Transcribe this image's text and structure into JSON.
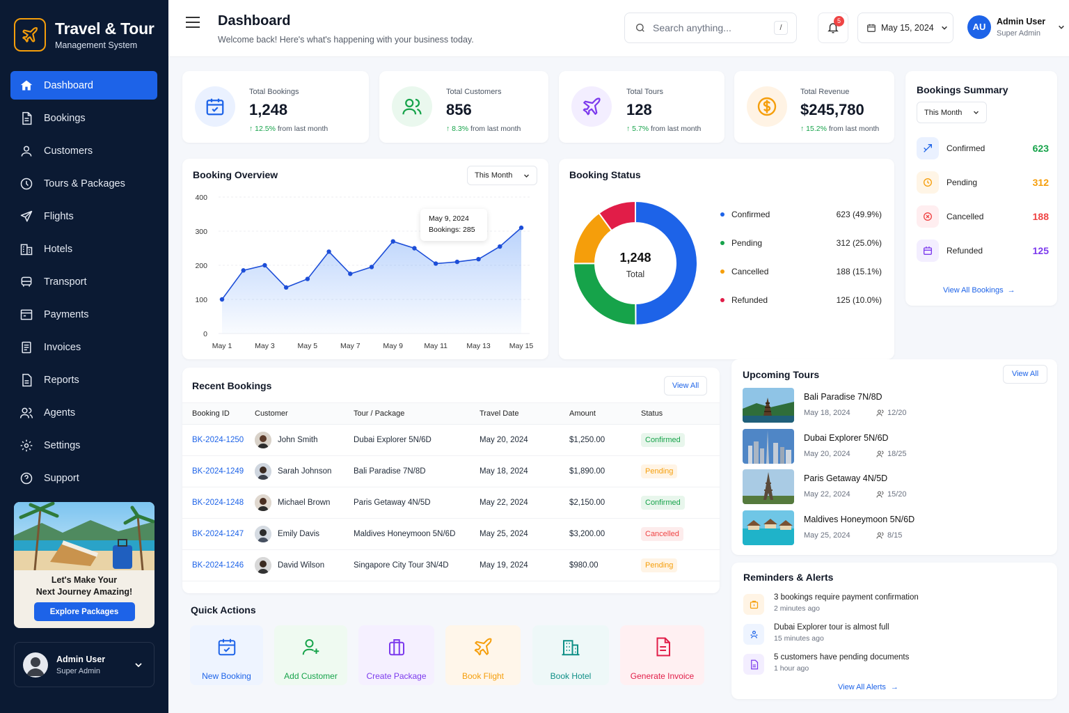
{
  "app": {
    "title": "Travel & Tour",
    "subtitle": "Management System"
  },
  "nav": [
    {
      "label": "Dashboard",
      "icon": "home-icon"
    },
    {
      "label": "Bookings",
      "icon": "document-icon"
    },
    {
      "label": "Customers",
      "icon": "user-icon"
    },
    {
      "label": "Tours & Packages",
      "icon": "compass-icon"
    },
    {
      "label": "Flights",
      "icon": "plane-icon"
    },
    {
      "label": "Hotels",
      "icon": "building-icon"
    },
    {
      "label": "Transport",
      "icon": "bus-icon"
    },
    {
      "label": "Payments",
      "icon": "card-icon"
    },
    {
      "label": "Invoices",
      "icon": "invoice-icon"
    },
    {
      "label": "Reports",
      "icon": "report-icon"
    },
    {
      "label": "Agents",
      "icon": "agents-icon"
    },
    {
      "label": "Settings",
      "icon": "gear-icon"
    },
    {
      "label": "Support",
      "icon": "help-icon"
    }
  ],
  "promo": {
    "line1": "Let's Make Your",
    "line2": "Next Journey Amazing!",
    "button": "Explore Packages"
  },
  "sidebar_user": {
    "name": "Admin User",
    "role": "Super Admin"
  },
  "header": {
    "title": "Dashboard",
    "subtitle": "Welcome back! Here's what's happening with your business today.",
    "search_placeholder": "Search anything...",
    "search_shortcut": "/",
    "notifications": "5",
    "date": "May 15, 2024",
    "user_initials": "AU",
    "user_name": "Admin User",
    "user_role": "Super Admin"
  },
  "stats": [
    {
      "label": "Total Bookings",
      "value": "1,248",
      "change": "12.5%",
      "suffix": "from last month"
    },
    {
      "label": "Total Customers",
      "value": "856",
      "change": "8.3%",
      "suffix": "from last month"
    },
    {
      "label": "Total Tours",
      "value": "128",
      "change": "5.7%",
      "suffix": "from last month"
    },
    {
      "label": "Total Revenue",
      "value": "$245,780",
      "change": "15.2%",
      "suffix": "from last month"
    }
  ],
  "summary": {
    "title": "Bookings Summary",
    "filter": "This Month",
    "rows": [
      {
        "label": "Confirmed",
        "value": "623",
        "color": "#16a34a"
      },
      {
        "label": "Pending",
        "value": "312",
        "color": "#f59e0b"
      },
      {
        "label": "Cancelled",
        "value": "188",
        "color": "#ef4444"
      },
      {
        "label": "Refunded",
        "value": "125",
        "color": "#7c3aed"
      }
    ],
    "link": "View All Bookings"
  },
  "overview": {
    "title": "Booking Overview",
    "filter": "This Month",
    "tooltip_date": "May 9, 2024",
    "tooltip_value": "Bookings: 285"
  },
  "status": {
    "title": "Booking Status",
    "total": "1,248",
    "total_label": "Total",
    "items": [
      {
        "label": "Confirmed",
        "value": "623 (49.9%)",
        "color": "#1d63e8"
      },
      {
        "label": "Pending",
        "value": "312 (25.0%)",
        "color": "#16a34a"
      },
      {
        "label": "Cancelled",
        "value": "188 (15.1%)",
        "color": "#f59e0b"
      },
      {
        "label": "Refunded",
        "value": "125 (10.0%)",
        "color": "#e11d48"
      }
    ]
  },
  "chart_data": {
    "type": "line",
    "x": [
      "May 1",
      "May 2",
      "May 3",
      "May 4",
      "May 5",
      "May 6",
      "May 7",
      "May 8",
      "May 9",
      "May 10",
      "May 11",
      "May 12",
      "May 13",
      "May 14",
      "May 15"
    ],
    "xticks": [
      "May 1",
      "May 3",
      "May 5",
      "May 7",
      "May 9",
      "May 11",
      "May 13",
      "May 15"
    ],
    "series": [
      {
        "values": [
          100,
          185,
          200,
          135,
          160,
          240,
          175,
          195,
          270,
          250,
          205,
          210,
          218,
          255,
          310
        ]
      }
    ],
    "yticks": [
      0,
      100,
      200,
      300,
      400
    ],
    "ylim": [
      0,
      400
    ],
    "area": true,
    "color": "#1d4ed8"
  },
  "donut_data": {
    "type": "pie",
    "labels": [
      "Confirmed",
      "Pending",
      "Cancelled",
      "Refunded"
    ],
    "values": [
      623,
      312,
      188,
      125
    ],
    "colors": [
      "#1d63e8",
      "#16a34a",
      "#f59e0b",
      "#e11d48"
    ]
  },
  "recent": {
    "title": "Recent Bookings",
    "view_all": "View All",
    "columns": [
      "Booking ID",
      "Customer",
      "Tour / Package",
      "Travel Date",
      "Amount",
      "Status"
    ],
    "rows": [
      {
        "id": "BK-2024-1250",
        "customer": "John Smith",
        "tour": "Dubai Explorer 5N/6D",
        "date": "May 20, 2024",
        "amount": "$1,250.00",
        "status": "Confirmed"
      },
      {
        "id": "BK-2024-1249",
        "customer": "Sarah Johnson",
        "tour": "Bali Paradise 7N/8D",
        "date": "May 18, 2024",
        "amount": "$1,890.00",
        "status": "Pending"
      },
      {
        "id": "BK-2024-1248",
        "customer": "Michael Brown",
        "tour": "Paris Getaway 4N/5D",
        "date": "May 22, 2024",
        "amount": "$2,150.00",
        "status": "Confirmed"
      },
      {
        "id": "BK-2024-1247",
        "customer": "Emily Davis",
        "tour": "Maldives Honeymoon 5N/6D",
        "date": "May 25, 2024",
        "amount": "$3,200.00",
        "status": "Cancelled"
      },
      {
        "id": "BK-2024-1246",
        "customer": "David Wilson",
        "tour": "Singapore City Tour 3N/4D",
        "date": "May 19, 2024",
        "amount": "$980.00",
        "status": "Pending"
      }
    ]
  },
  "quick": {
    "title": "Quick Actions",
    "items": [
      {
        "label": "New Booking",
        "color": "#1d63e8",
        "bg": "#eef4ff"
      },
      {
        "label": "Add Customer",
        "color": "#16a34a",
        "bg": "#effaf1"
      },
      {
        "label": "Create Package",
        "color": "#7c3aed",
        "bg": "#f5f0ff"
      },
      {
        "label": "Book Flight",
        "color": "#f59e0b",
        "bg": "#fff6ea"
      },
      {
        "label": "Book Hotel",
        "color": "#0e8f86",
        "bg": "#eef8f8"
      },
      {
        "label": "Generate Invoice",
        "color": "#e11d48",
        "bg": "#fff0f2"
      }
    ]
  },
  "upcoming": {
    "title": "Upcoming Tours",
    "view_all": "View All",
    "items": [
      {
        "name": "Bali Paradise 7N/8D",
        "date": "May 18, 2024",
        "capacity": "12/20"
      },
      {
        "name": "Dubai Explorer 5N/6D",
        "date": "May 20, 2024",
        "capacity": "18/25"
      },
      {
        "name": "Paris Getaway 4N/5D",
        "date": "May 22, 2024",
        "capacity": "15/20"
      },
      {
        "name": "Maldives Honeymoon 5N/6D",
        "date": "May 25, 2024",
        "capacity": "8/15"
      }
    ]
  },
  "alerts": {
    "title": "Reminders & Alerts",
    "items": [
      {
        "text": "3 bookings require payment confirmation",
        "time": "2 minutes ago"
      },
      {
        "text": "Dubai Explorer tour is almost full",
        "time": "15 minutes ago"
      },
      {
        "text": "5 customers have pending documents",
        "time": "1 hour ago"
      }
    ],
    "link": "View All Alerts"
  }
}
